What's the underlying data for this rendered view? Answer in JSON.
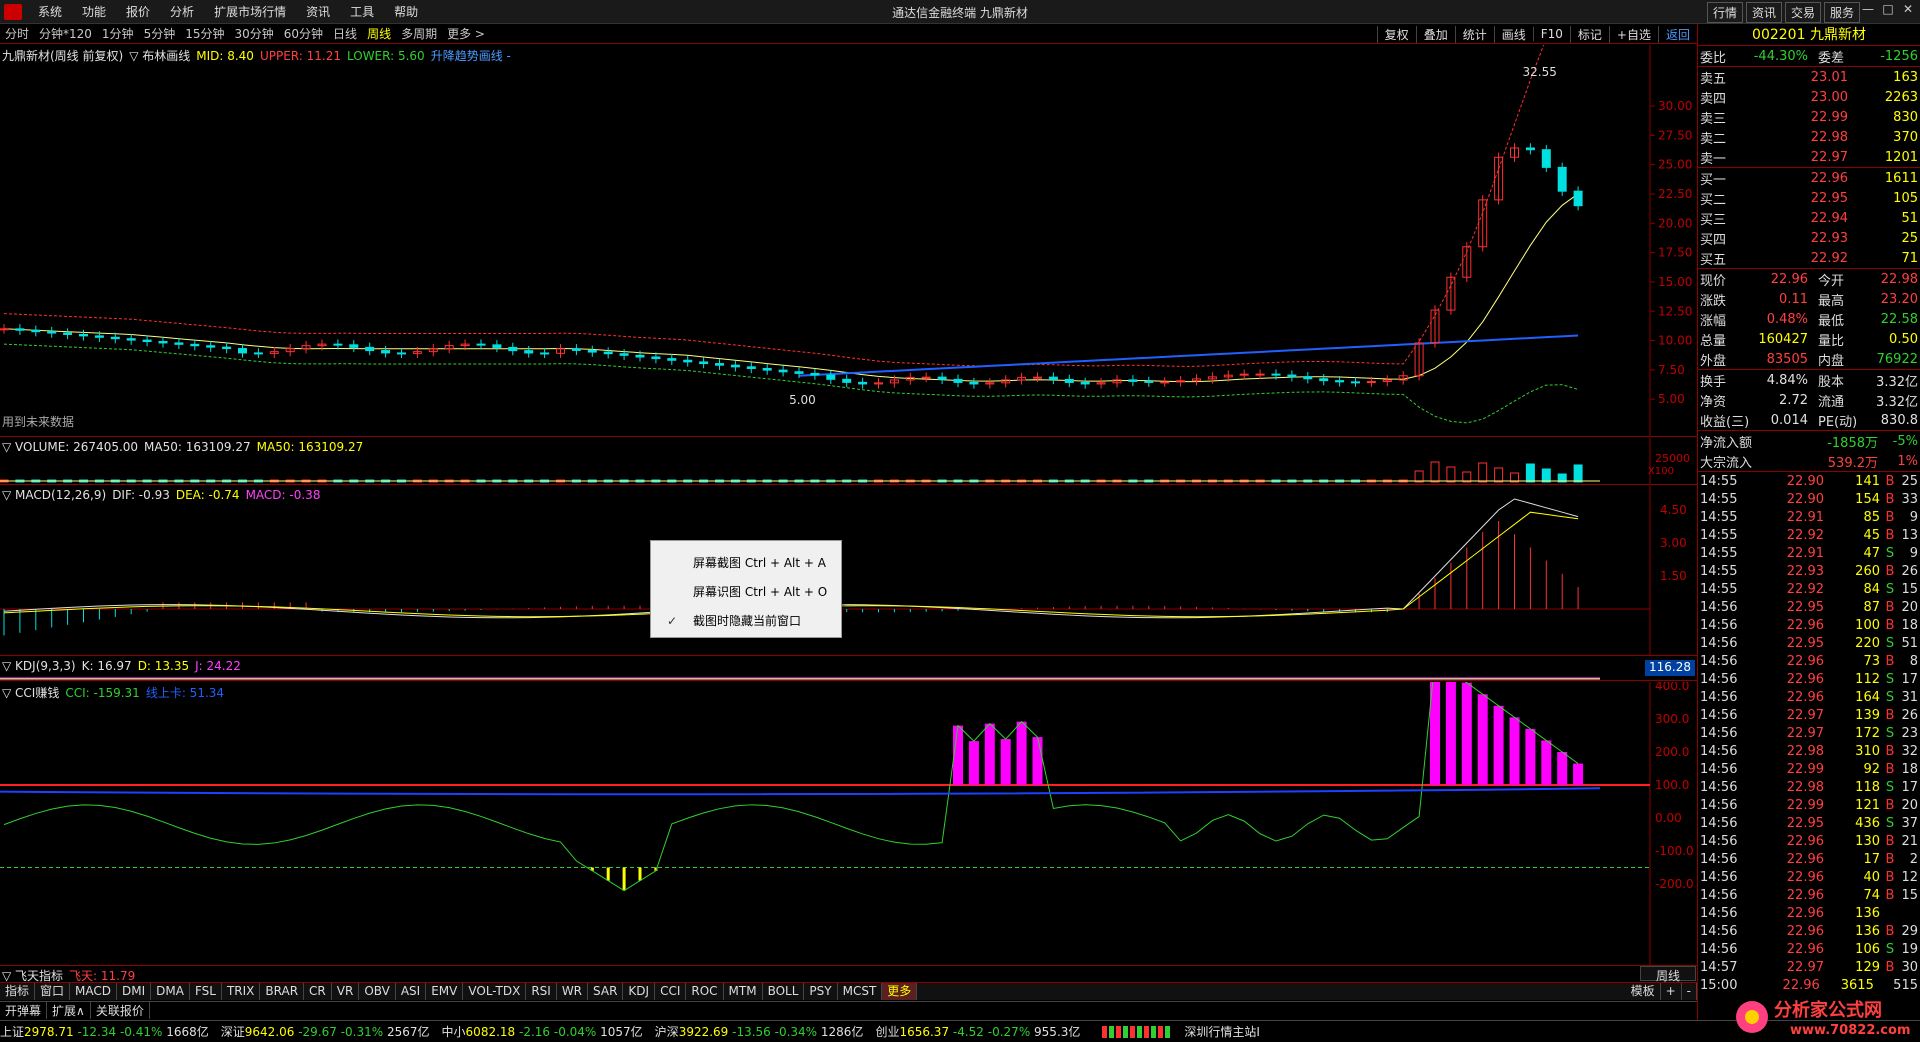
{
  "app_title": "通达信金融终端 九鼎新材",
  "menu": [
    "系统",
    "功能",
    "报价",
    "分析",
    "扩展市场行情",
    "资讯",
    "工具",
    "帮助"
  ],
  "top_right_buttons": [
    "行情",
    "资讯",
    "交易",
    "服务"
  ],
  "periods": [
    "分时",
    "分钟*120",
    "1分钟",
    "5分钟",
    "15分钟",
    "30分钟",
    "60分钟",
    "日线",
    "周线",
    "多周期",
    "更多 >"
  ],
  "active_period": "周线",
  "chart_tools": [
    "复权",
    "叠加",
    "统计",
    "画线",
    "F10",
    "标记",
    "+自选",
    "返回"
  ],
  "main_legend": {
    "name": "九鼎新材(周线 前复权)",
    "indicator": "▽ 布林画线",
    "mid": "MID: 8.40",
    "upper": "UPPER: 11.21",
    "lower": "LOWER: 5.60",
    "trend": "升降趋势画线 -"
  },
  "future_data_label": "用到未来数据",
  "price_ticks": [
    "30.00",
    "27.50",
    "25.00",
    "22.50",
    "20.00",
    "17.50",
    "15.00",
    "12.50",
    "10.00",
    "7.50",
    "5.00"
  ],
  "price_high_label": "32.55",
  "price_low_label": "5.00",
  "volume_legend": {
    "name": "▽ VOLUME: 267405.00",
    "ma1": "MA50: 163109.27",
    "ma2": "MA50: 163109.27"
  },
  "volume_ticks": {
    "top": "25000",
    "unit": "X100"
  },
  "macd_legend": {
    "name": "▽ MACD(12,26,9)",
    "dif": "DIF: -0.93",
    "dea": "DEA: -0.74",
    "macd": "MACD: -0.38"
  },
  "macd_ticks": [
    "4.50",
    "3.00",
    "1.50"
  ],
  "kdj_legend": {
    "name": "▽ KDJ(9,3,3)",
    "k": "K: 16.97",
    "d": "D: 13.35",
    "j": "J: 24.22"
  },
  "kdj_value_box": "116.28",
  "cci_legend": {
    "name": "▽ CCI赚钱",
    "cci": "CCI: -159.31",
    "line": "线上卡: 51.34"
  },
  "cci_ticks": [
    "500.0",
    "400.0",
    "300.0",
    "200.0",
    "100.0",
    "0.00",
    "-100.0",
    "-200.0"
  ],
  "bottom_indicator": {
    "name": "▽ 飞天指标",
    "val": "飞天: 11.79"
  },
  "indicator_tabs": [
    "指标",
    "窗口",
    "MACD",
    "DMI",
    "DMA",
    "FSL",
    "TRIX",
    "BRAR",
    "CR",
    "VR",
    "OBV",
    "ASI",
    "EMV",
    "VOL-TDX",
    "RSI",
    "WR",
    "SAR",
    "KDJ",
    "CCI",
    "ROC",
    "MTM",
    "BOLL",
    "PSY",
    "MCST",
    "更多"
  ],
  "indicator_right": [
    "模板",
    "+",
    "-"
  ],
  "period_right_label": "周线",
  "bottom_tabs": [
    "开弹幕",
    "扩展∧",
    "关联报价"
  ],
  "status": [
    {
      "label": "上证",
      "price": "2978.71",
      "chg": "-12.34",
      "pct": "-0.41%",
      "amt": "1668亿"
    },
    {
      "label": "深证",
      "price": "9642.06",
      "chg": "-29.67",
      "pct": "-0.31%",
      "amt": "2567亿"
    },
    {
      "label": "中小",
      "price": "6082.18",
      "chg": "-2.16",
      "pct": "-0.04%",
      "amt": "1057亿"
    },
    {
      "label": "沪深",
      "price": "3922.69",
      "chg": "-13.56",
      "pct": "-0.34%",
      "amt": "1286亿"
    },
    {
      "label": "创业",
      "price": "1656.37",
      "chg": "-4.52",
      "pct": "-0.27%",
      "amt": "955.3亿"
    }
  ],
  "status_right": "深圳行情主站I",
  "side": {
    "code_name": "002201 九鼎新材",
    "weibi": {
      "l1": "委比",
      "v1": "-44.30%",
      "l2": "委差",
      "v2": "-1256"
    },
    "asks": [
      {
        "label": "卖五",
        "price": "23.01",
        "vol": "163"
      },
      {
        "label": "卖四",
        "price": "23.00",
        "vol": "2263"
      },
      {
        "label": "卖三",
        "price": "22.99",
        "vol": "830"
      },
      {
        "label": "卖二",
        "price": "22.98",
        "vol": "370"
      },
      {
        "label": "卖一",
        "price": "22.97",
        "vol": "1201"
      }
    ],
    "bids": [
      {
        "label": "买一",
        "price": "22.96",
        "vol": "1611"
      },
      {
        "label": "买二",
        "price": "22.95",
        "vol": "105"
      },
      {
        "label": "买三",
        "price": "22.94",
        "vol": "51"
      },
      {
        "label": "买四",
        "price": "22.93",
        "vol": "25"
      },
      {
        "label": "买五",
        "price": "22.92",
        "vol": "71"
      }
    ],
    "quote1": [
      {
        "l1": "现价",
        "v1": "22.96",
        "c1": "up",
        "l2": "今开",
        "v2": "22.98",
        "c2": "up"
      },
      {
        "l1": "涨跌",
        "v1": "0.11",
        "c1": "up",
        "l2": "最高",
        "v2": "23.20",
        "c2": "up"
      },
      {
        "l1": "涨幅",
        "v1": "0.48%",
        "c1": "up",
        "l2": "最低",
        "v2": "22.58",
        "c2": "dn"
      },
      {
        "l1": "总量",
        "v1": "160427",
        "c1": "yl",
        "l2": "量比",
        "v2": "0.50",
        "c2": "yl"
      },
      {
        "l1": "外盘",
        "v1": "83505",
        "c1": "up",
        "l2": "内盘",
        "v2": "76922",
        "c2": "dn"
      }
    ],
    "quote2": [
      {
        "l1": "换手",
        "v1": "4.84%",
        "c1": "wt",
        "l2": "股本",
        "v2": "3.32亿",
        "c2": "wt"
      },
      {
        "l1": "净资",
        "v1": "2.72",
        "c1": "wt",
        "l2": "流通",
        "v2": "3.32亿",
        "c2": "wt"
      },
      {
        "l1": "收益(三)",
        "v1": "0.014",
        "c1": "wt",
        "l2": "PE(动)",
        "v2": "830.8",
        "c2": "wt"
      }
    ],
    "flow": [
      {
        "label": "净流入额",
        "v": "-1858万",
        "p": "-5%",
        "c": "dn"
      },
      {
        "label": "大宗流入",
        "v": "539.2万",
        "p": "1%",
        "c": "up"
      }
    ],
    "ticks": [
      [
        "14:55",
        "22.90",
        "141",
        "B",
        "25"
      ],
      [
        "14:55",
        "22.90",
        "154",
        "B",
        "33"
      ],
      [
        "14:55",
        "22.91",
        "85",
        "B",
        "9"
      ],
      [
        "14:55",
        "22.92",
        "45",
        "B",
        "13"
      ],
      [
        "14:55",
        "22.91",
        "47",
        "S",
        "9"
      ],
      [
        "14:55",
        "22.93",
        "260",
        "B",
        "26"
      ],
      [
        "14:55",
        "22.92",
        "84",
        "S",
        "15"
      ],
      [
        "14:56",
        "22.95",
        "87",
        "B",
        "20"
      ],
      [
        "14:56",
        "22.96",
        "100",
        "B",
        "18"
      ],
      [
        "14:56",
        "22.95",
        "220",
        "S",
        "51"
      ],
      [
        "14:56",
        "22.96",
        "73",
        "B",
        "8"
      ],
      [
        "14:56",
        "22.96",
        "112",
        "S",
        "17"
      ],
      [
        "14:56",
        "22.96",
        "164",
        "S",
        "31"
      ],
      [
        "14:56",
        "22.97",
        "139",
        "B",
        "26"
      ],
      [
        "14:56",
        "22.97",
        "172",
        "S",
        "23"
      ],
      [
        "14:56",
        "22.98",
        "310",
        "B",
        "32"
      ],
      [
        "14:56",
        "22.99",
        "92",
        "B",
        "18"
      ],
      [
        "14:56",
        "22.98",
        "118",
        "S",
        "17"
      ],
      [
        "14:56",
        "22.99",
        "121",
        "B",
        "20"
      ],
      [
        "14:56",
        "22.95",
        "436",
        "S",
        "37"
      ],
      [
        "14:56",
        "22.96",
        "130",
        "B",
        "21"
      ],
      [
        "14:56",
        "22.96",
        "17",
        "B",
        "2"
      ],
      [
        "14:56",
        "22.96",
        "40",
        "B",
        "12"
      ],
      [
        "14:56",
        "22.96",
        "74",
        "B",
        "15"
      ],
      [
        "14:56",
        "22.96",
        "136",
        "",
        ""
      ],
      [
        "14:56",
        "22.96",
        "136",
        "B",
        "29"
      ],
      [
        "14:56",
        "22.96",
        "106",
        "S",
        "19"
      ],
      [
        "14:57",
        "22.97",
        "129",
        "B",
        "30"
      ],
      [
        "15:00",
        "22.96",
        "3615",
        "",
        "515"
      ]
    ]
  },
  "context_menu": [
    "屏幕截图 Ctrl + Alt + A",
    "屏幕识图 Ctrl + Alt + O",
    "截图时隐藏当前窗口"
  ],
  "watermark": {
    "title": "分析家公式网",
    "url": "www.70822.com"
  },
  "colors": {
    "up": "#ff3030",
    "down": "#00e0e0",
    "upper": "#ff3030",
    "mid": "#ffff80",
    "lower": "#30d030",
    "ma": "#2060ff",
    "accent": "#ffff00",
    "cci_bar": "#ff00ff"
  }
}
